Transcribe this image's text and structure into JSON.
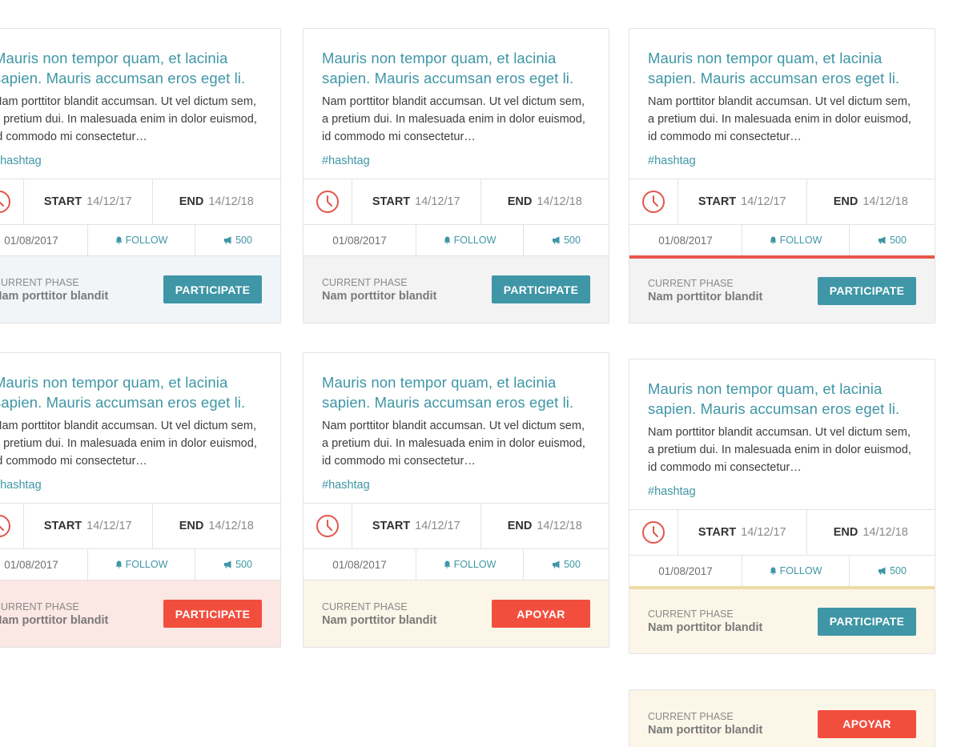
{
  "cards": [
    {
      "title": "Mauris non tempor quam, et lacinia sapien. Mauris accumsan eros eget li.",
      "description": "Nam porttitor blandit accumsan. Ut vel dictum sem, a pretium dui. In malesuada enim in dolor euismod, id commodo mi consectetur…",
      "hashtag": "#hashtag",
      "start_label": "START",
      "start_date": "14/12/17",
      "end_label": "END",
      "end_date": "14/12/18",
      "created": "01/08/2017",
      "follow_label": "FOLLOW",
      "supporters": "500",
      "phase_label": "CURRENT PHASE",
      "phase_value": "Nam porttitor blandit",
      "button_label": "PARTICIPATE",
      "button_color": "#3f96a6",
      "footer_bg": "#f1f5f8"
    },
    {
      "title": "Mauris non tempor quam, et lacinia sapien. Mauris accumsan eros eget li.",
      "description": "Nam porttitor blandit accumsan. Ut vel dictum sem, a pretium dui. In malesuada enim in dolor euismod, id commodo mi consectetur…",
      "hashtag": "#hashtag",
      "start_label": "START",
      "start_date": "14/12/17",
      "end_label": "END",
      "end_date": "14/12/18",
      "created": "01/08/2017",
      "follow_label": "FOLLOW",
      "supporters": "500",
      "phase_label": "CURRENT PHASE",
      "phase_value": "Nam porttitor blandit",
      "button_label": "PARTICIPATE",
      "button_color": "#3f96a6",
      "footer_bg": "#f3f3f3"
    },
    {
      "title": "Mauris non tempor quam, et lacinia sapien. Mauris accumsan eros eget li.",
      "description": "Nam porttitor blandit accumsan. Ut vel dictum sem, a pretium dui. In malesuada enim in dolor euismod, id commodo mi consectetur…",
      "hashtag": "#hashtag",
      "start_label": "START",
      "start_date": "14/12/17",
      "end_label": "END",
      "end_date": "14/12/18",
      "created": "01/08/2017",
      "follow_label": "FOLLOW",
      "supporters": "500",
      "phase_label": "CURRENT PHASE",
      "phase_value": "Nam porttitor blandit",
      "button_label": "PARTICIPATE",
      "button_color": "#3f96a6",
      "footer_bg": "#f3f3f3",
      "accent_color": "#e9564a"
    },
    {
      "title": "Mauris non tempor quam, et lacinia sapien. Mauris accumsan eros eget li.",
      "description": "Nam porttitor blandit accumsan. Ut vel dictum sem, a pretium dui. In malesuada enim in dolor euismod, id commodo mi consectetur…",
      "hashtag": "#hashtag",
      "start_label": "START",
      "start_date": "14/12/17",
      "end_label": "END",
      "end_date": "14/12/18",
      "created": "01/08/2017",
      "follow_label": "FOLLOW",
      "supporters": "500",
      "phase_label": "CURRENT PHASE",
      "phase_value": "Nam porttitor blandit",
      "button_label": "PARTICIPATE",
      "button_color": "#f24e3e",
      "footer_bg": "#fbe7e3"
    },
    {
      "title": "Mauris non tempor quam, et lacinia sapien. Mauris accumsan eros eget li.",
      "description": "Nam porttitor blandit accumsan. Ut vel dictum sem, a pretium dui. In malesuada enim in dolor euismod, id commodo mi consectetur…",
      "hashtag": "#hashtag",
      "start_label": "START",
      "start_date": "14/12/17",
      "end_label": "END",
      "end_date": "14/12/18",
      "created": "01/08/2017",
      "follow_label": "FOLLOW",
      "supporters": "500",
      "phase_label": "CURRENT PHASE",
      "phase_value": "Nam porttitor blandit",
      "button_label": "APOYAR",
      "button_color": "#f24e3e",
      "footer_bg": "#fcf6e8"
    },
    {
      "title": "Mauris non tempor quam, et lacinia sapien. Mauris accumsan eros eget li.",
      "description": "Nam porttitor blandit accumsan. Ut vel dictum sem, a pretium dui. In malesuada enim in dolor euismod, id commodo mi consectetur…",
      "hashtag": "#hashtag",
      "start_label": "START",
      "start_date": "14/12/17",
      "end_label": "END",
      "end_date": "14/12/18",
      "created": "01/08/2017",
      "follow_label": "FOLLOW",
      "supporters": "500",
      "phase_label": "CURRENT PHASE",
      "phase_value": "Nam porttitor blandit",
      "button_label": "PARTICIPATE",
      "button_color": "#3f96a6",
      "footer_bg": "#fcf6e8",
      "accent_color": "#ecdca3"
    }
  ],
  "footer_only_card": {
    "phase_label": "CURRENT PHASE",
    "phase_value": "Nam porttitor blandit",
    "button_label": "APOYAR",
    "button_color": "#f24e3e",
    "footer_bg": "#fcf6e8"
  },
  "icons": {
    "clock": "clock-icon",
    "follow": "bell-icon",
    "supporters": "megaphone-icon"
  },
  "colors": {
    "accent_teal": "#3f96a6",
    "accent_red": "#f24e3e",
    "clock_red": "#e2574c"
  }
}
